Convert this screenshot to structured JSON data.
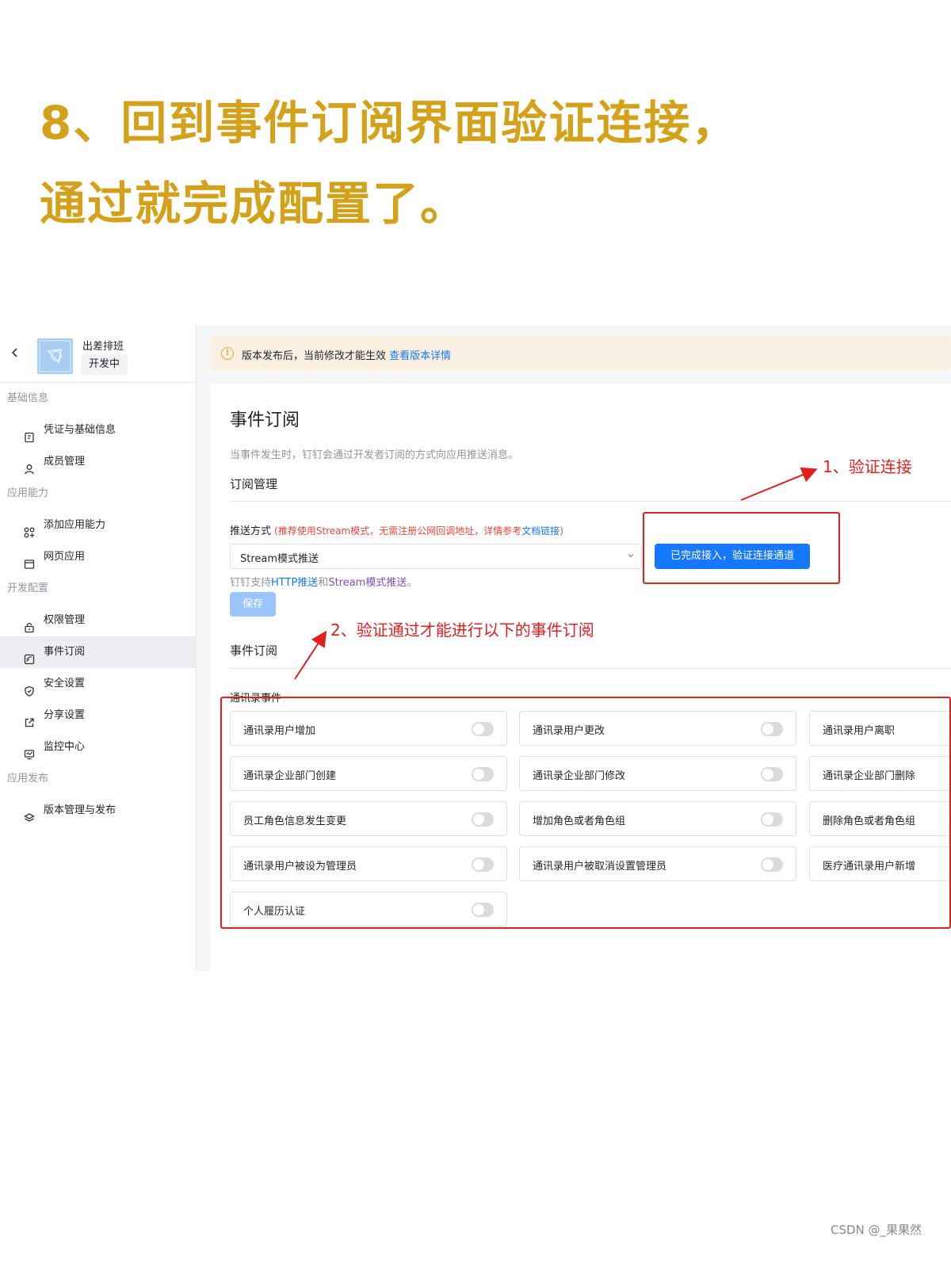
{
  "headline": {
    "line1": "8、回到事件订阅界面验证连接，",
    "line2": "通过就完成配置了。"
  },
  "colors": {
    "headline": "#d4a21a",
    "accent": "#1677ff",
    "annotation": "#e02020"
  },
  "app": {
    "name": "出差排班",
    "status": "开发中"
  },
  "sidebar": {
    "groups": [
      {
        "label": "基础信息",
        "items": [
          {
            "label": "凭证与基础信息",
            "icon": "credential-icon"
          },
          {
            "label": "成员管理",
            "icon": "user-icon"
          }
        ]
      },
      {
        "label": "应用能力",
        "items": [
          {
            "label": "添加应用能力",
            "icon": "apps-grid-icon"
          },
          {
            "label": "网页应用",
            "icon": "browser-window-icon"
          }
        ]
      },
      {
        "label": "开发配置",
        "items": [
          {
            "label": "权限管理",
            "icon": "lock-icon"
          },
          {
            "label": "事件订阅",
            "icon": "event-subscribe-icon",
            "active": true
          },
          {
            "label": "安全设置",
            "icon": "shield-icon"
          },
          {
            "label": "分享设置",
            "icon": "share-icon"
          },
          {
            "label": "监控中心",
            "icon": "monitor-icon"
          }
        ]
      },
      {
        "label": "应用发布",
        "items": [
          {
            "label": "版本管理与发布",
            "icon": "layers-icon"
          }
        ]
      }
    ]
  },
  "notice": {
    "text": "版本发布后，当前修改才能生效 ",
    "link": "查看版本详情"
  },
  "panel": {
    "title": "事件订阅",
    "description": "当事件发生时，钉钉会通过开发者订阅的方式向应用推送消息。",
    "subscription_section": "订阅管理",
    "push_label": "推送方式 ",
    "push_hint": "(推荐使用Stream模式，无需注册公网回调地址，详情参考",
    "push_hint_link": "文档链接",
    "push_hint_end": ")",
    "push_value": "Stream模式推送",
    "verify_button": "已完成接入，验证连接通道",
    "support_prefix": "钉钉支持",
    "support_http": "HTTP推送",
    "support_and": "和",
    "support_stream": "Stream模式推送",
    "support_end": "。",
    "save_button": "保存",
    "event_section": "事件订阅",
    "event_group": "通讯录事件",
    "events": [
      {
        "label": "通讯录用户增加",
        "enabled": false
      },
      {
        "label": "通讯录用户更改",
        "enabled": false
      },
      {
        "label": "通讯录用户离职",
        "enabled": false
      },
      {
        "label": "通讯录企业部门创建",
        "enabled": false
      },
      {
        "label": "通讯录企业部门修改",
        "enabled": false
      },
      {
        "label": "通讯录企业部门删除",
        "enabled": false
      },
      {
        "label": "员工角色信息发生变更",
        "enabled": false
      },
      {
        "label": "增加角色或者角色组",
        "enabled": false
      },
      {
        "label": "删除角色或者角色组",
        "enabled": false
      },
      {
        "label": "通讯录用户被设为管理员",
        "enabled": false
      },
      {
        "label": "通讯录用户被取消设置管理员",
        "enabled": false
      },
      {
        "label": "医疗通讯录用户新增",
        "enabled": false
      },
      {
        "label": "个人履历认证",
        "enabled": false
      }
    ]
  },
  "annotations": {
    "step1": "1、验证连接",
    "step2": "2、验证通过才能进行以下的事件订阅"
  },
  "watermark": "CSDN @_果果然"
}
